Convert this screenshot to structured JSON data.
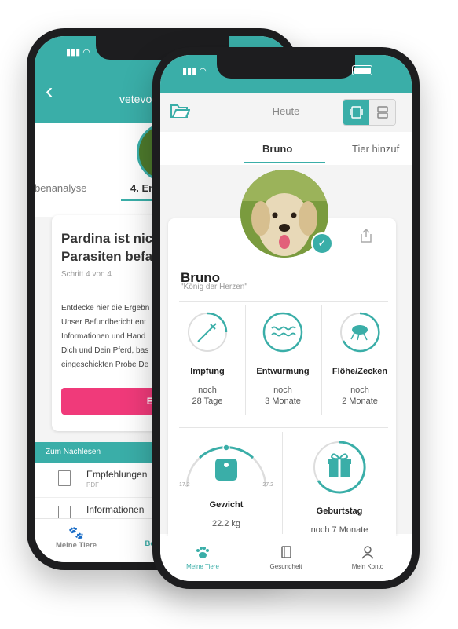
{
  "back_phone": {
    "header_title": "vetevo",
    "steps": {
      "previous": "benanalyse",
      "current": "4. En"
    },
    "card": {
      "title_line1": "Pardina ist nic",
      "title_line2": "Parasiten befal",
      "subtitle": "Schritt 4 von 4",
      "paragraph_lines": [
        "Entdecke hier die Ergebn",
        "Unser Befundbericht ent",
        "Informationen und Hand",
        "Dich und Dein Pferd, bas",
        "eingeschickten Probe De"
      ],
      "button_label": "Ergebniss"
    },
    "section_label": "Zum Nachlesen",
    "documents": [
      {
        "title": "Empfehlungen",
        "type": "PDF"
      },
      {
        "title": "Informationen",
        "type": ""
      }
    ],
    "nav": {
      "item1": "Meine Tiere",
      "item2": "Behan"
    }
  },
  "front_phone": {
    "header_title": "Heute",
    "tabs": {
      "active": "Bruno",
      "other": "Tier hinzuf"
    },
    "pet": {
      "name": "Bruno",
      "motto": "\"König der Herzen\""
    },
    "stats": [
      {
        "label": "Impfung",
        "line1": "noch",
        "line2": "28 Tage",
        "icon": "syringe-icon"
      },
      {
        "label": "Entwurmung",
        "line1": "noch",
        "line2": "3 Monate",
        "icon": "worm-icon"
      },
      {
        "label": "Flöhe/Zecken",
        "line1": "noch",
        "line2": "2 Monate",
        "icon": "flea-icon"
      }
    ],
    "weight": {
      "label": "Gewicht",
      "value": "22.2 kg",
      "min": "17.2",
      "max": "27.2"
    },
    "birthday": {
      "label": "Geburtstag",
      "value": "noch 7 Monate"
    },
    "nav": {
      "item1": "Meine Tiere",
      "item2": "Gesundheit",
      "item3": "Mein Konto"
    }
  },
  "colors": {
    "accent": "#3aaea8",
    "cta": "#f03a7a"
  }
}
